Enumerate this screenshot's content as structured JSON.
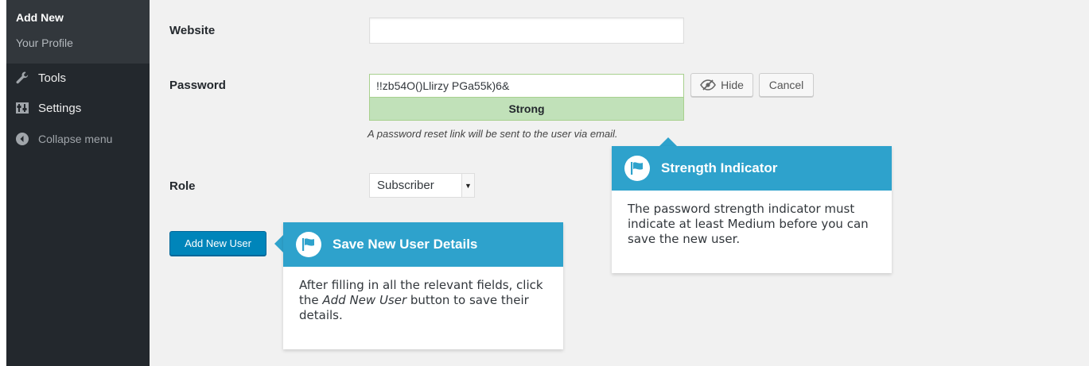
{
  "sidebar": {
    "submenu": [
      {
        "label": "Add New",
        "current": true
      },
      {
        "label": "Your Profile",
        "current": false
      }
    ],
    "items": [
      {
        "label": "Tools",
        "icon": "wrench-icon"
      },
      {
        "label": "Settings",
        "icon": "settings-icon"
      },
      {
        "label": "Collapse menu",
        "icon": "collapse-arrow-icon"
      }
    ]
  },
  "form": {
    "website_label": "Website",
    "website_value": "",
    "password_label": "Password",
    "password_value": "!!zb54O()Llirzy PGa55k)6&",
    "strength": "Strong",
    "hide_label": "Hide",
    "cancel_label": "Cancel",
    "hint": "A password reset link will be sent to the user via email.",
    "role_label": "Role",
    "role_value": "Subscriber",
    "submit_label": "Add New User"
  },
  "pointers": {
    "strength": {
      "title": "Strength Indicator",
      "body": "The password strength indicator must indicate at least Medium before you can save the new user."
    },
    "save": {
      "title": "Save New User Details",
      "body_before": "After filling in all the relevant fields, click the ",
      "body_em": "Add New User",
      "body_after": " button to save their details."
    }
  },
  "colors": {
    "sidebar": "#23282d",
    "accent": "#2ea2cc",
    "primary_button": "#0085ba",
    "strength_bg": "#c1e1b9"
  }
}
